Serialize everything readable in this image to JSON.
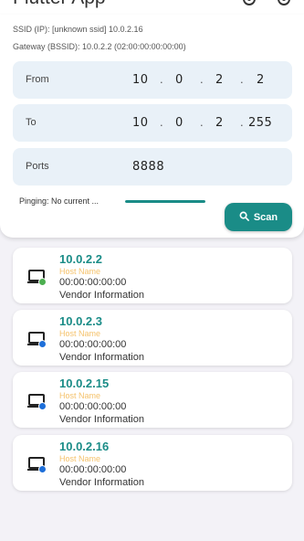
{
  "app_bar": {
    "title": "Flutter App"
  },
  "network": {
    "ssid_line": "SSID (IP): [unknown ssid] 10.0.2.16",
    "gateway_line": "Gateway (BSSID): 10.0.2.2 (02:00:00:00:00:00)"
  },
  "range": {
    "from": {
      "label": "From",
      "octets": [
        "10",
        "0",
        "2",
        "2"
      ]
    },
    "to": {
      "label": "To",
      "octets": [
        "10",
        "0",
        "2",
        "255"
      ]
    }
  },
  "ports": {
    "label": "Ports",
    "value": "8888"
  },
  "status": {
    "pinging_text": "Pinging: No current ...",
    "progress": 1.0
  },
  "scan_button": {
    "label": "Scan"
  },
  "colors": {
    "accent": "#1a8c87",
    "online_dot": "#4caf50",
    "offline_dot": "#1e6fd9",
    "hostname": "#f5c26b"
  },
  "hosts": [
    {
      "ip": "10.0.2.2",
      "host_name": "Host Name",
      "mac": "00:00:00:00:00",
      "vendor": "Vendor Information",
      "status_color": "#4caf50"
    },
    {
      "ip": "10.0.2.3",
      "host_name": "Host Name",
      "mac": "00:00:00:00:00",
      "vendor": "Vendor Information",
      "status_color": "#1e6fd9"
    },
    {
      "ip": "10.0.2.15",
      "host_name": "Host Name",
      "mac": "00:00:00:00:00",
      "vendor": "Vendor Information",
      "status_color": "#1e6fd9"
    },
    {
      "ip": "10.0.2.16",
      "host_name": "Host Name",
      "mac": "00:00:00:00:00",
      "vendor": "Vendor Information",
      "status_color": "#1e6fd9"
    }
  ]
}
